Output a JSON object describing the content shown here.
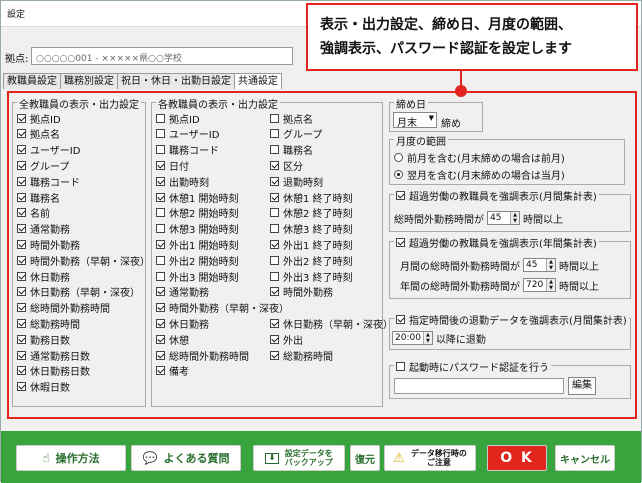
{
  "window": {
    "title": "設定"
  },
  "branch": {
    "label": "拠点:",
    "value": "○○○○○001 - ×××××県○○学校"
  },
  "tabs": [
    "教職員設定",
    "職務別設定",
    "祝日・休日・出勤日設定",
    "共通設定"
  ],
  "callout": {
    "line1": "表示・出力設定、締め日、月度の範囲、",
    "line2": "強調表示、パスワード認証を設定します"
  },
  "all_staff": {
    "title": "全教職員の表示・出力設定",
    "items": [
      {
        "label": "拠点ID",
        "checked": true
      },
      {
        "label": "拠点名",
        "checked": true
      },
      {
        "label": "ユーザーID",
        "checked": true
      },
      {
        "label": "グループ",
        "checked": true
      },
      {
        "label": "職務コード",
        "checked": true
      },
      {
        "label": "職務名",
        "checked": true
      },
      {
        "label": "名前",
        "checked": true
      },
      {
        "label": "通常勤務",
        "checked": true
      },
      {
        "label": "時間外勤務",
        "checked": true
      },
      {
        "label": "時間外勤務（早朝・深夜）",
        "checked": true
      },
      {
        "label": "休日勤務",
        "checked": true
      },
      {
        "label": "休日勤務（早朝・深夜）",
        "checked": true
      },
      {
        "label": "総時間外勤務時間",
        "checked": true
      },
      {
        "label": "総勤務時間",
        "checked": true
      },
      {
        "label": "勤務日数",
        "checked": true
      },
      {
        "label": "通常勤務日数",
        "checked": true
      },
      {
        "label": "休日勤務日数",
        "checked": true
      },
      {
        "label": "休暇日数",
        "checked": true
      }
    ]
  },
  "each_staff": {
    "title": "各教職員の表示・出力設定",
    "col1": [
      {
        "label": "拠点ID",
        "checked": false
      },
      {
        "label": "ユーザーID",
        "checked": false
      },
      {
        "label": "職務コード",
        "checked": false
      },
      {
        "label": "日付",
        "checked": true
      },
      {
        "label": "出勤時刻",
        "checked": true
      },
      {
        "label": "休憩1 開始時刻",
        "checked": true
      },
      {
        "label": "休憩2 開始時刻",
        "checked": false
      },
      {
        "label": "休憩3 開始時刻",
        "checked": false
      },
      {
        "label": "外出1 開始時刻",
        "checked": true
      },
      {
        "label": "外出2 開始時刻",
        "checked": false
      },
      {
        "label": "外出3 開始時刻",
        "checked": false
      },
      {
        "label": "通常勤務",
        "checked": true
      },
      {
        "label": "時間外勤務（早朝・深夜）",
        "checked": true
      },
      {
        "label": "休日勤務",
        "checked": true
      },
      {
        "label": "休憩",
        "checked": true
      },
      {
        "label": "総時間外勤務時間",
        "checked": true
      },
      {
        "label": "備考",
        "checked": true
      }
    ],
    "col2": [
      {
        "label": "拠点名",
        "checked": false
      },
      {
        "label": "グループ",
        "checked": false
      },
      {
        "label": "職務名",
        "checked": false
      },
      {
        "label": "区分",
        "checked": true
      },
      {
        "label": "退勤時刻",
        "checked": true
      },
      {
        "label": "休憩1 終了時刻",
        "checked": true
      },
      {
        "label": "休憩2 終了時刻",
        "checked": false
      },
      {
        "label": "休憩3 終了時刻",
        "checked": false
      },
      {
        "label": "外出1 終了時刻",
        "checked": true
      },
      {
        "label": "外出2 終了時刻",
        "checked": false
      },
      {
        "label": "外出3 終了時刻",
        "checked": false
      },
      {
        "label": "時間外勤務",
        "checked": true
      },
      {
        "label": "",
        "checked": false
      },
      {
        "label": "休日勤務（早朝・深夜）",
        "checked": true
      },
      {
        "label": "外出",
        "checked": true
      },
      {
        "label": "総勤務時間",
        "checked": true
      }
    ]
  },
  "closing": {
    "title": "締め日",
    "value": "月末",
    "suffix": "締め"
  },
  "month_range": {
    "title": "月度の範囲",
    "options": [
      {
        "label": "前月を含む(月末締めの場合は前月)",
        "selected": false
      },
      {
        "label": "翌月を含む(月末締めの場合は当月)",
        "selected": true
      }
    ]
  },
  "monthly_hl": {
    "label": "超過労働の教職員を強調表示(月間集計表)",
    "checked": true,
    "row_label": "総時間外勤務時間が",
    "value": "45",
    "suffix": "時間以上"
  },
  "yearly_hl": {
    "label": "超過労働の教職員を強調表示(年間集計表)",
    "checked": true,
    "row1_label": "月間の総時間外勤務時間が",
    "row1_value": "45",
    "row2_label": "年間の総時間外勤務時間が",
    "row2_value": "720",
    "suffix": "時間以上"
  },
  "late_hl": {
    "label": "指定時間後の退勤データを強調表示(月間集計表)",
    "checked": true,
    "value": "20:00",
    "suffix": "以降に退勤"
  },
  "password": {
    "label": "起動時にパスワード認証を行う",
    "checked": false,
    "edit_label": "編集"
  },
  "footer": {
    "howto": "操作方法",
    "faq": "よくある質問",
    "backup_l1": "設定データを",
    "backup_l2": "バックアップ",
    "restore": "復元",
    "migrate_l1": "データ移行時の",
    "migrate_l2": "ご注意",
    "ok": "O K",
    "cancel": "キャンセル"
  }
}
